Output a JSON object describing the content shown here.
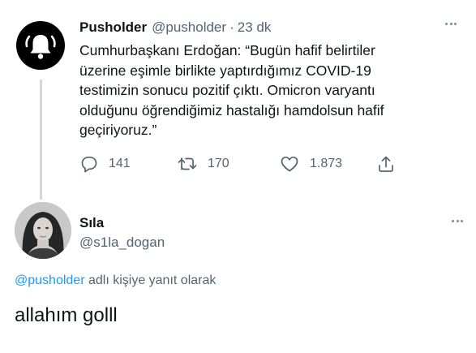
{
  "original_tweet": {
    "author_name": "Pusholder",
    "author_handle": "@pusholder",
    "separator": "·",
    "time_ago": "23 dk",
    "avatar_icon": "bell-icon",
    "text": "Cumhurbaşkanı Erdoğan: “Bugün hafif belirtiler\nüzerine eşimle birlikte yaptırdığımız COVID-19\ntestimizin sonucu pozitif çıktı. Omicron varyantı\nolduğunu öğrendiğimiz hastalığı hamdolsun hafif\ngeçiriyoruz.”",
    "actions": {
      "reply_count": "141",
      "retweet_count": "170",
      "like_count": "1.873",
      "reply_icon": "reply-icon",
      "retweet_icon": "retweet-icon",
      "like_icon": "heart-icon",
      "share_icon": "share-icon"
    }
  },
  "reply_tweet": {
    "author_name": "Sıla",
    "author_handle": "@s1la_dogan",
    "replying_to_mention": "@pusholder",
    "replying_to_suffix": " adlı kişiye yanıt olarak",
    "text": "allahım golll"
  },
  "colors": {
    "text_primary": "#0f1419",
    "text_secondary": "#536471",
    "link": "#1d9bf0",
    "thread_line": "#cfd9de",
    "avatar_bg": "#000000"
  }
}
